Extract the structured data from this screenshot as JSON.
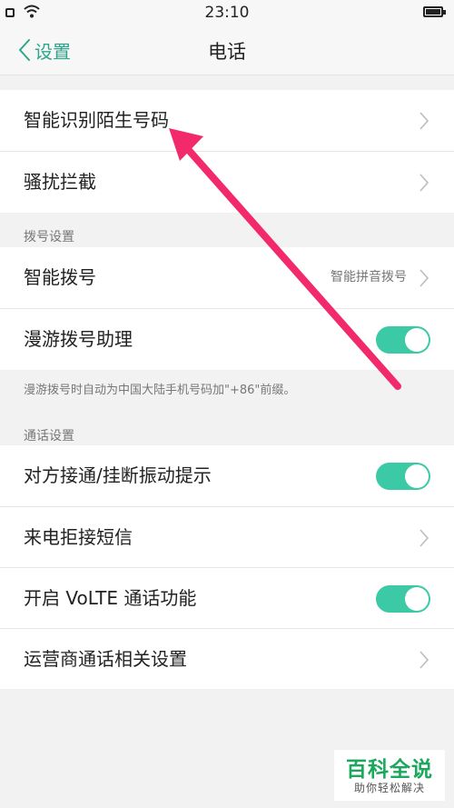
{
  "status_bar": {
    "time": "23:10"
  },
  "nav": {
    "back_label": "设置",
    "title": "电话"
  },
  "group1": [
    {
      "label": "智能识别陌生号码"
    },
    {
      "label": "骚扰拦截"
    }
  ],
  "dial_section": {
    "header": "拨号设置",
    "smart_dial": {
      "label": "智能拨号",
      "value": "智能拼音拨号"
    },
    "roaming": {
      "label": "漫游拨号助理",
      "on": true
    },
    "note": "漫游拨号时自动为中国大陆手机号码加\"+86\"前缀。"
  },
  "call_section": {
    "header": "通话设置",
    "vibrate": {
      "label": "对方接通/挂断振动提示",
      "on": true
    },
    "reject_sms": {
      "label": "来电拒接短信"
    },
    "volte": {
      "label": "开启 VoLTE 通话功能",
      "on": true
    },
    "carrier": {
      "label": "运营商通话相关设置"
    }
  },
  "watermark": {
    "title": "百科全说",
    "subtitle": "助你轻松解决"
  },
  "colors": {
    "accent": "#2fa58b",
    "toggle_on": "#3cc9a6",
    "arrow": "#f2296b"
  }
}
